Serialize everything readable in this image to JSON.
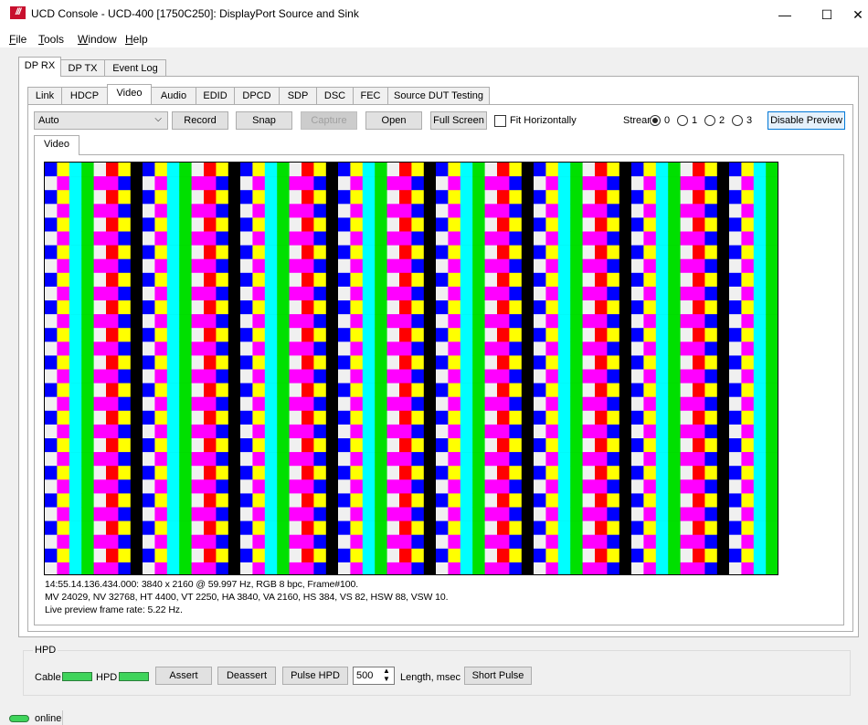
{
  "window": {
    "logo_text": "///",
    "title": "UCD Console - UCD-400 [1750C250]: DisplayPort Source and Sink",
    "minimize": "—",
    "maximize": "☐",
    "close": "✕"
  },
  "menu": {
    "items": [
      {
        "label": "File",
        "mnemonic": "F",
        "rest": "ile"
      },
      {
        "label": "Tools",
        "mnemonic": "T",
        "rest": "ools"
      },
      {
        "label": "Window",
        "mnemonic": "W",
        "rest": "indow"
      },
      {
        "label": "Help",
        "mnemonic": "H",
        "rest": "elp"
      }
    ]
  },
  "top_tabs": [
    "DP RX",
    "DP TX",
    "Event Log"
  ],
  "sub_tabs": [
    "Link",
    "HDCP",
    "Video",
    "Audio",
    "EDID",
    "DPCD",
    "SDP",
    "DSC",
    "FEC",
    "Source DUT Testing"
  ],
  "toolbar": {
    "mode_value": "Auto",
    "record": "Record",
    "snap": "Snap",
    "capture": "Capture",
    "open": "Open",
    "full_screen": "Full Screen",
    "fit_horizontally": "Fit Horizontally",
    "stream_label": "Stream:",
    "streams": [
      "0",
      "1",
      "2",
      "3"
    ],
    "stream_selected": "0",
    "disable_preview": "Disable Preview"
  },
  "inner_tab": "Video",
  "video_info": {
    "line1": "14:55.14.136.434.000: 3840 x 2160 @ 59.997 Hz, RGB 8 bpc, Frame#100.",
    "line2": "MV 24029, NV 32768, HT 4400, VT 2250, HA 3840, VA 2160, HS 384, VS 82, HSW 88, VSW 10.",
    "line3": "Live preview frame rate: 5.22 Hz."
  },
  "pattern_colors": {
    "white": "#f0f0f0",
    "yellow": "#ffff00",
    "cyan": "#00ffff",
    "green": "#00e000",
    "magenta": "#ff00ff",
    "red": "#ff0000",
    "blue": "#0000ff",
    "black": "#000000"
  },
  "hpd": {
    "group_label": "HPD",
    "cable_label": "Cable",
    "hpd_label": "HPD",
    "assert": "Assert",
    "deassert": "Deassert",
    "pulse_hpd": "Pulse HPD",
    "length_value": "500",
    "length_label": "Length, msec",
    "short_pulse": "Short Pulse",
    "led_color": "#3fd45b"
  },
  "status": {
    "online": "online"
  }
}
